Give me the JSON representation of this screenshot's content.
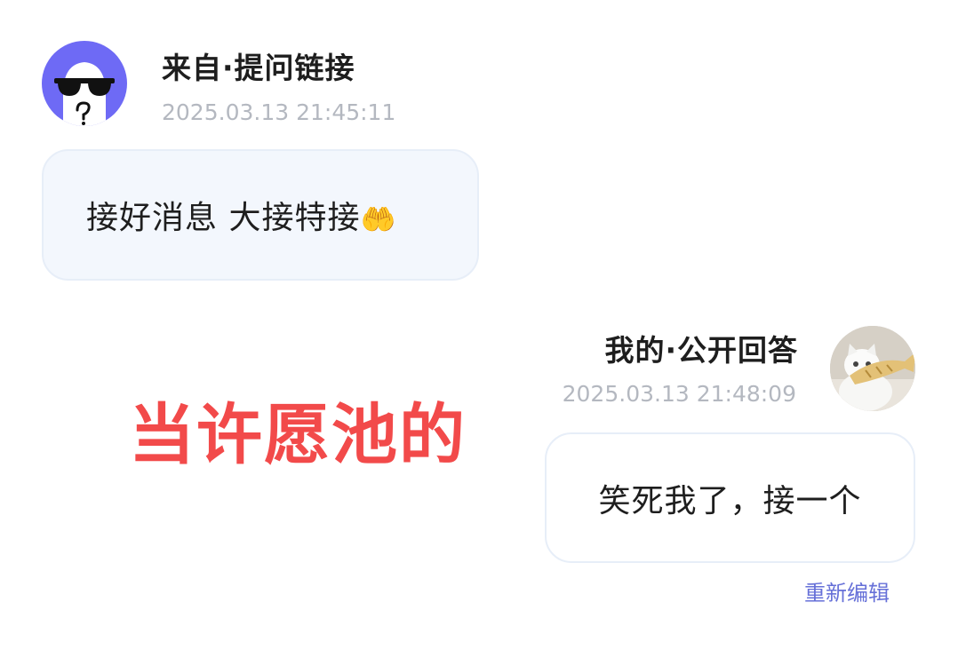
{
  "incoming": {
    "sender_label": "来自·提问链接",
    "timestamp": "2025.03.13 21:45:11",
    "message": "接好消息 大接特接",
    "emoji_icon": "palms-up-together-icon",
    "avatar_bg": "#6e6af5"
  },
  "outgoing": {
    "sender_label": "我的·公开回答",
    "timestamp": "2025.03.13 21:48:09",
    "message": "笑死我了，接一个",
    "re_edit_label": "重新编辑"
  },
  "overlay": {
    "caption": "当许愿池的"
  },
  "colors": {
    "caption": "#f24a4a",
    "link": "#6670d8",
    "timestamp": "#b4b8c0",
    "bubble_in": "#f3f7fd"
  }
}
